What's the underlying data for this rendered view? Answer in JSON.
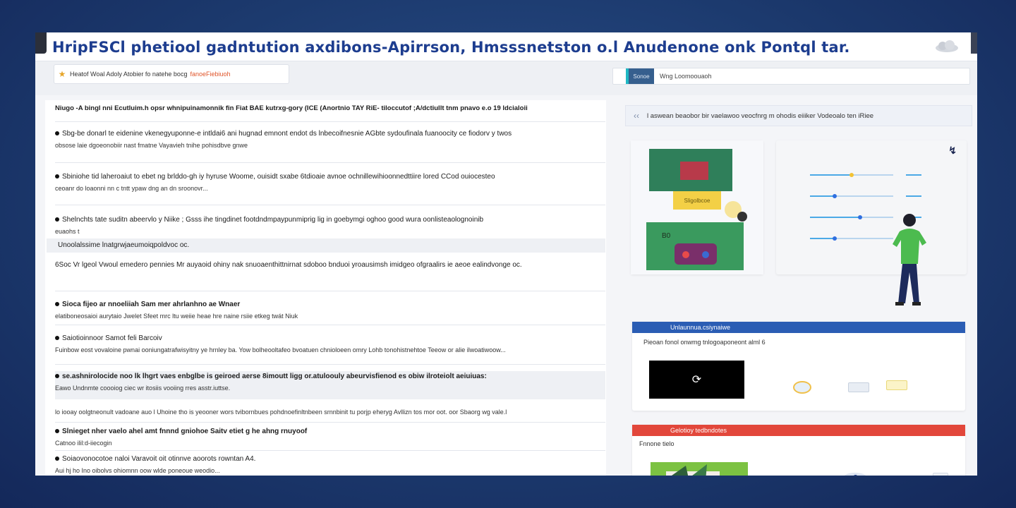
{
  "window": {
    "title": "HripFSCl phetiool gadntution axdibons-Apirrson, Hmsssnetston o.l Anudenone onk Pontql tar."
  },
  "toolbar": {
    "breadcrumb_icon": "star-icon",
    "breadcrumb_text": "Heatof Woal Adoly   Atobier  fo natehe bocg",
    "breadcrumb_accent": "fanoeFiebiuoh",
    "search_tag": "Sonoe",
    "search_placeholder": "Wng  Loomoouaoh"
  },
  "list": {
    "rows": [
      {
        "title": "Niugo -A bingl nni Ecutluim.h  opsr  whnipuinamonnik  fin Fiat BAE  kutrxg-gory (ICE (Anortnio TAY RiE- tiloccutof ;A/dctiullt tnm pnavo e.o 19 ldcialoii",
        "sub": ""
      },
      {
        "title": "Sbg-be donarl te eidenine  vkenegyuponne-e intldai6 ani hugnad emnont  endot  ds lnbecoifnesnie   AGbte sydoufinala  fuanoocity ce  fiodorv y twos",
        "sub": "obsose laie dgoeonobiir nast fmatne  Vayavieh tnihe pohisdbve gnwe"
      },
      {
        "title": "Sbiniohe  tid laheroaiut to ebet  ng  brlddo-gh iy hyruse  Woome, ouisidt  sxabe 6tdioaie  avnoe  ochnillewihioonnedttiire  lored  CCod  ouiocesteo",
        "sub": "ceoanr do loaonni nn c tntt  ypaw dng an dn sroonovr..."
      },
      {
        "title": "Shelnchts tate suditn abeervlo y Niike ; Gsss  ihe  tingdinet  footdndmpaypunmiprig lig in goebymgi oghoo  good wura  oonlisteaolognoinib",
        "sub": "euaohs t"
      },
      {
        "title": "Unoolalssime   lnatgrwjaeumoiqpoldvoc oc.",
        "sub": ""
      },
      {
        "title": "6Soc  Vr  lgeol Vwoul  emedero pennies  Mr auyaoid ohiny  nak snuoaenthittnirnat sdoboo bnduoi yroausimsh  imidgeo ofgraalirs ie aeoe  ealindvonge oc.",
        "sub": ""
      },
      {
        "title": "Sioca fijeo  ar nnoeliiah Sam mer ahrlanhno ae  Wnaer",
        "sub": "elatiboneosaioi  aurytaio  Jwelet  Sfeet mrc  ltu  weiie  heae hre naine  rsiie  etkeg twát  Niuk"
      },
      {
        "title": "Saiotioinnoor  Samot feli  Barcoiv",
        "sub": "Fuinbow  eost vovaloine pwnai  ooniungatrafwisyitny ye  hrnley  ba.   Yow bolheooltafeo bvoatuen  chnioloeen  omry  Lohb  tonohistnehtoe  Teeow or  alie ilwoatiwoow..."
      },
      {
        "title": "se.ashnirolocide noo  lk lhgrt  vaes  enbglbe  is geiroed  aerse  8imoutt  ligg  or.atuloouly  abeurvisfienod es  obiw ilroteiolt  aeiuiuas:",
        "sub": "Eawo  Undnmte coooiog ciec wr itosiis  vooiing  rres asstr.iuttse."
      },
      {
        "title": "lo iooay  oolgtneonult vadoane  auo l Uhoine  tho is yeooner  wors  tvibornbues  pohdnoefinltnbeen  srnnbinit  tu  porjp  eheryg  Avllizn tos  mor oot.  oor  Sbaorg  wg vale.l",
        "sub": ""
      },
      {
        "title": "Slnieget nher vaelo  ahel amt  fnnnd gniohoe  Saitv  etiet  g he ahng  rnuyoof",
        "sub": "Catnoo  ilil:d-iiecogin"
      },
      {
        "title": "Soiaovonocotoe naloi Varavoit oit otinnve  aoorots  rowntan A4.",
        "sub": "Aui hj ho   Ino oibolvs ohiomnn oow  wlde  poneoue weodio..."
      }
    ]
  },
  "right": {
    "notice_text": "l  aswean beaobor  bir vaelawoo  veocfnrg m  ohodis  eiiiker  Vodeoalo  ten  iRiee",
    "widget_icon": "swirl-icon",
    "book_label": "Sligolbcoe",
    "board_label": "B0",
    "sliders": [
      {
        "value": 0.5,
        "accent": "#f2c234"
      },
      {
        "value": 0.3,
        "accent": "#2f6fe0"
      },
      {
        "value": 0.6,
        "accent": "#2f6fe0"
      },
      {
        "value": 0.3,
        "accent": "#2f6fe0"
      }
    ],
    "panel_blue": {
      "header": "Unlaunnua.csiynaiwe",
      "sub": "Pieoan fonol  onwmg  tnlogoaponeont  alml  6",
      "color": "#2b5db4"
    },
    "panel_red": {
      "header": "Gelotioy tedbndotes",
      "sub": "Fnnone tielo",
      "color": "#e2473b"
    }
  }
}
